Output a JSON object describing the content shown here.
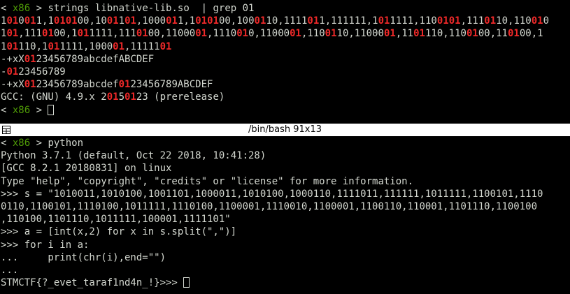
{
  "colors": {
    "background": "#000000",
    "foreground": "#d3d7cf",
    "prompt_host": "#4e9a06",
    "highlight": "#ef2929",
    "titlebar_bg": "#ffffff",
    "titlebar_fg": "#000000"
  },
  "top_terminal": {
    "prompt": {
      "open": "< ",
      "host": "x86",
      "close": " > "
    },
    "command": "strings libnative-lib.so  | grep 01",
    "binary_lines": [
      "1010011,1010100,1001101,1000011,1010100,1000110,1111011,111111,1011111,1100101,1110110,110010",
      "101,1110100,1011111,1110100,1100001,1110010,1100001,1100110,1100001,1101110,1100100,110100,1",
      "101110,1011111,100001,1111101"
    ],
    "output_lines": [
      "-+xX0123456789abcdefABCDEF",
      "-0123456789",
      "-+xX0123456789abcdef0123456789ABCDEF",
      "GCC: (GNU) 4.9.x 20150123 (prerelease)"
    ],
    "match": "01"
  },
  "titlebar": {
    "icon": "split-pane-icon",
    "title": "/bin/bash 91x13"
  },
  "bottom_terminal": {
    "prompt": {
      "open": "< ",
      "host": "x86",
      "close": " > "
    },
    "command": "python",
    "lines": [
      "Python 3.7.1 (default, Oct 22 2018, 10:41:28)",
      "[GCC 8.2.1 20180831] on linux",
      "Type \"help\", \"copyright\", \"credits\" or \"license\" for more information.",
      ">>> s = \"1010011,1010100,1001101,1000011,1010100,1000110,1111011,111111,1011111,1100101,1110",
      "0110,1100101,1110100,1011111,1110100,1100001,1110010,1100001,1100110,110001,1101110,1100100",
      ",110100,1101110,1011111,100001,1111101\"",
      ">>> a = [int(x,2) for x in s.split(\",\")]",
      ">>> for i in a:",
      "...     print(chr(i),end=\"\")",
      "..."
    ],
    "result": "STMCTF{?_evet_taraf1nd4n_!}",
    "ps1": ">>> "
  }
}
